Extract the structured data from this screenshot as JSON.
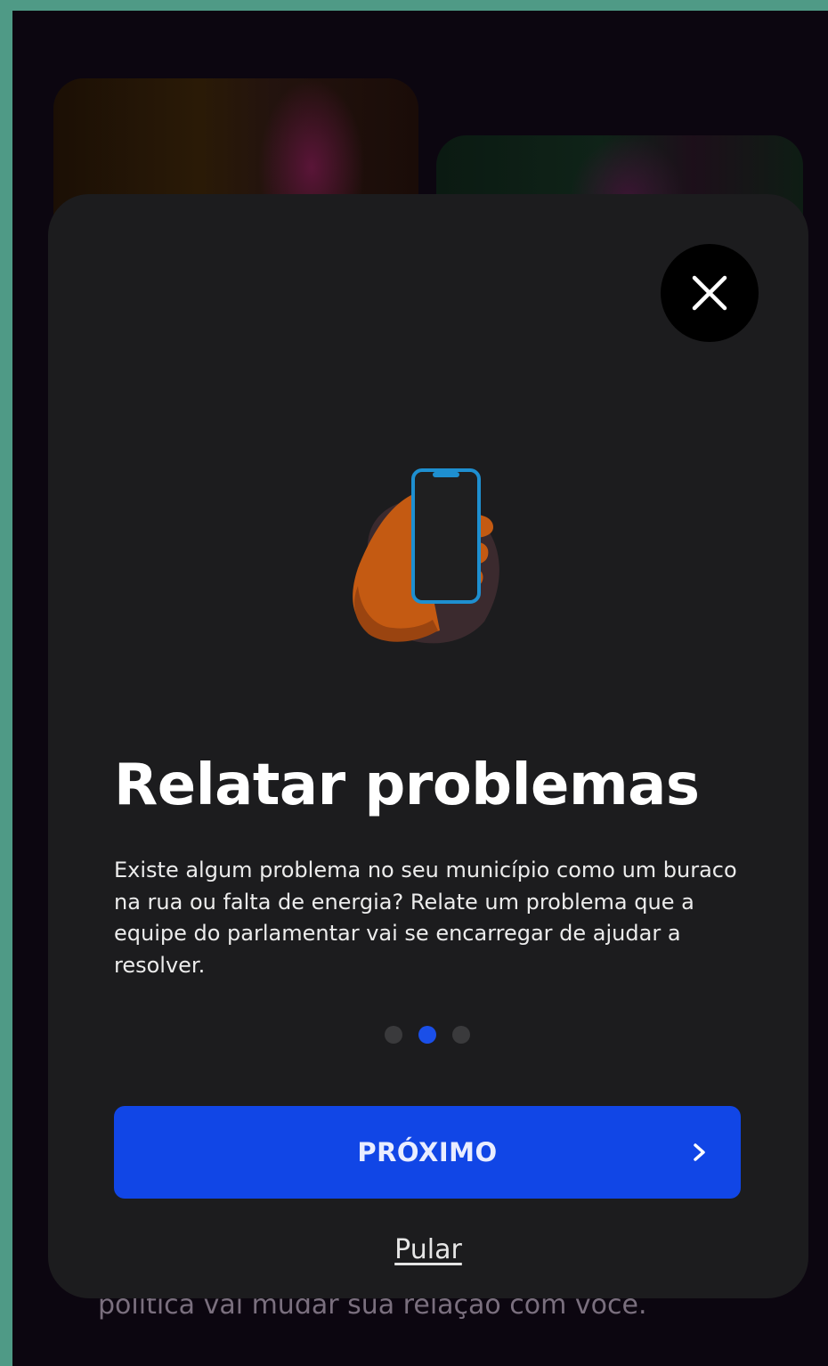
{
  "background": {
    "behind_text": "política vai mudar sua relação com você."
  },
  "modal": {
    "close_icon": "close-icon",
    "illustration_icon": "hand-holding-phone-illustration",
    "title": "Relatar problemas",
    "description": "Existe algum problema no seu município como um buraco na rua ou falta de energia? Relate um problema que a equipe do parlamentar vai se encarregar de ajudar a resolver.",
    "pagination": {
      "total": 3,
      "current": 2
    },
    "next_label": "PRÓXIMO",
    "next_icon": "chevron-right-icon",
    "skip_label": "Pular"
  },
  "colors": {
    "primary": "#1146e6",
    "modal_bg": "#1c1c1e",
    "page_bg": "#0c0610",
    "frame_bg": "#4f9a86",
    "phone_outline": "#1e8fd0",
    "hand": "#c45a12"
  }
}
